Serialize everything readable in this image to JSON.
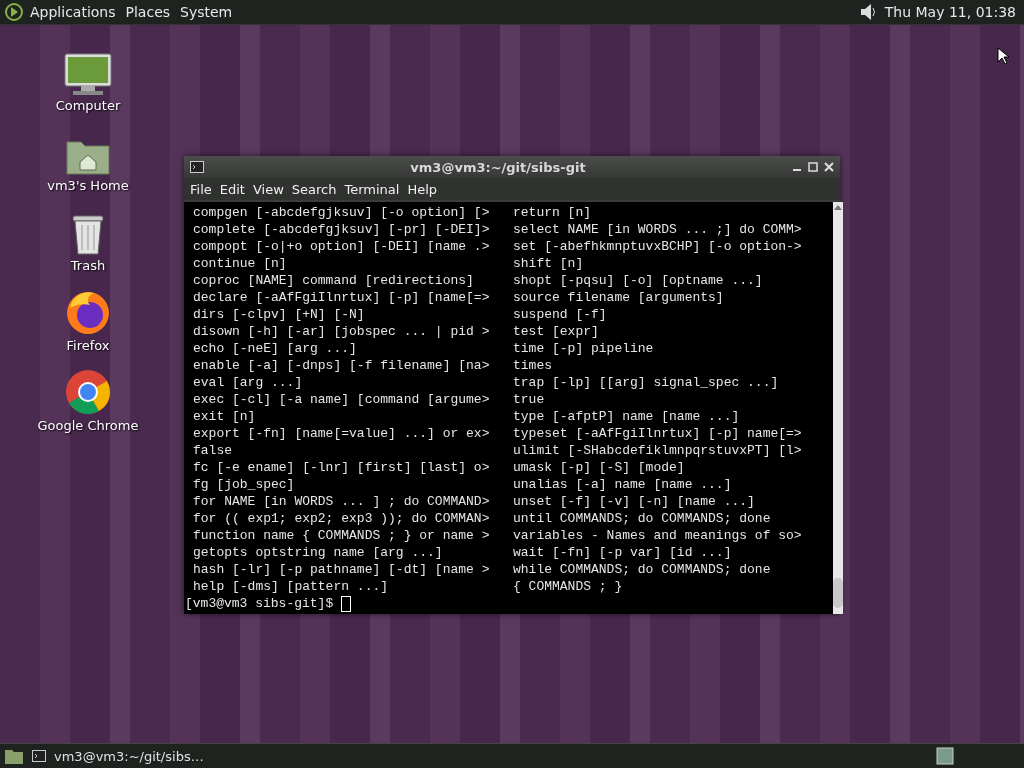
{
  "top_panel": {
    "menus": [
      "Applications",
      "Places",
      "System"
    ],
    "clock": "Thu May 11, 01:38"
  },
  "desktop_icons": [
    {
      "kind": "computer",
      "label": "Computer"
    },
    {
      "kind": "home",
      "label": "vm3's Home"
    },
    {
      "kind": "trash",
      "label": "Trash"
    },
    {
      "kind": "firefox",
      "label": "Firefox"
    },
    {
      "kind": "chrome",
      "label": "Google Chrome"
    }
  ],
  "terminal": {
    "title": "vm3@vm3:~/git/sibs-git",
    "menu": [
      "File",
      "Edit",
      "View",
      "Search",
      "Terminal",
      "Help"
    ],
    "rows": [
      {
        "left": "compgen [-abcdefgjksuv] [-o option] [>",
        "right": "return [n]"
      },
      {
        "left": "complete [-abcdefgjksuv] [-pr] [-DEI]>",
        "right": "select NAME [in WORDS ... ;] do COMM>"
      },
      {
        "left": "compopt [-o|+o option] [-DEI] [name .>",
        "right": "set [-abefhkmnptuvxBCHP] [-o option->"
      },
      {
        "left": "continue [n]",
        "right": "shift [n]"
      },
      {
        "left": "coproc [NAME] command [redirections]",
        "right": "shopt [-pqsu] [-o] [optname ...]"
      },
      {
        "left": "declare [-aAfFgiIlnrtux] [-p] [name[=>",
        "right": "source filename [arguments]"
      },
      {
        "left": "dirs [-clpv] [+N] [-N]",
        "right": "suspend [-f]"
      },
      {
        "left": "disown [-h] [-ar] [jobspec ... | pid >",
        "right": "test [expr]"
      },
      {
        "left": "echo [-neE] [arg ...]",
        "right": "time [-p] pipeline"
      },
      {
        "left": "enable [-a] [-dnps] [-f filename] [na>",
        "right": "times"
      },
      {
        "left": "eval [arg ...]",
        "right": "trap [-lp] [[arg] signal_spec ...]"
      },
      {
        "left": "exec [-cl] [-a name] [command [argume>",
        "right": "true"
      },
      {
        "left": "exit [n]",
        "right": "type [-afptP] name [name ...]"
      },
      {
        "left": "export [-fn] [name[=value] ...] or ex>",
        "right": "typeset [-aAfFgiIlnrtux] [-p] name[=>"
      },
      {
        "left": "false",
        "right": "ulimit [-SHabcdefiklmnpqrstuvxPT] [l>"
      },
      {
        "left": "fc [-e ename] [-lnr] [first] [last] o>",
        "right": "umask [-p] [-S] [mode]"
      },
      {
        "left": "fg [job_spec]",
        "right": "unalias [-a] name [name ...]"
      },
      {
        "left": "for NAME [in WORDS ... ] ; do COMMAND>",
        "right": "unset [-f] [-v] [-n] [name ...]"
      },
      {
        "left": "for (( exp1; exp2; exp3 )); do COMMAN>",
        "right": "until COMMANDS; do COMMANDS; done"
      },
      {
        "left": "function name { COMMANDS ; } or name >",
        "right": "variables - Names and meanings of so>"
      },
      {
        "left": "getopts optstring name [arg ...]",
        "right": "wait [-fn] [-p var] [id ...]"
      },
      {
        "left": "hash [-lr] [-p pathname] [-dt] [name >",
        "right": "while COMMANDS; do COMMANDS; done"
      },
      {
        "left": "help [-dms] [pattern ...]",
        "right": "{ COMMANDS ; }"
      }
    ],
    "prompt": "[vm3@vm3 sibs-git]$ "
  },
  "bottom_panel": {
    "tasks": [
      {
        "label": "vm3@vm3:~/git/sibs…",
        "selected": false
      }
    ]
  }
}
